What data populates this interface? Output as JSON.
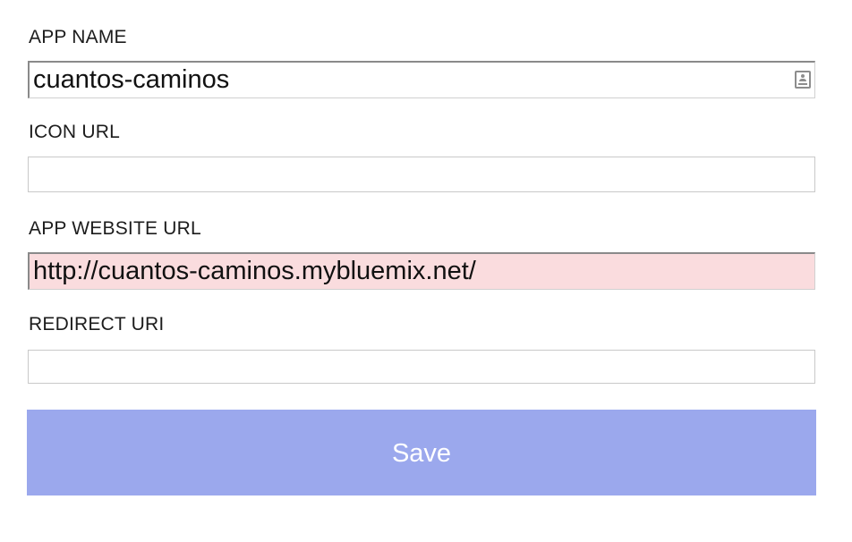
{
  "form": {
    "app_name": {
      "label": "APP NAME",
      "value": "cuantos-caminos",
      "autofill_icon": "contact-card-icon"
    },
    "icon_url": {
      "label": "ICON URL",
      "value": ""
    },
    "app_website_url": {
      "label": "APP WEBSITE URL",
      "value": "http://cuantos-caminos.mybluemix.net/",
      "state": "invalid",
      "invalid_bg": "#fadcde"
    },
    "redirect_uri": {
      "label": "REDIRECT URI",
      "value": ""
    },
    "save_label": "Save",
    "save_color": "#9ba8ed"
  }
}
